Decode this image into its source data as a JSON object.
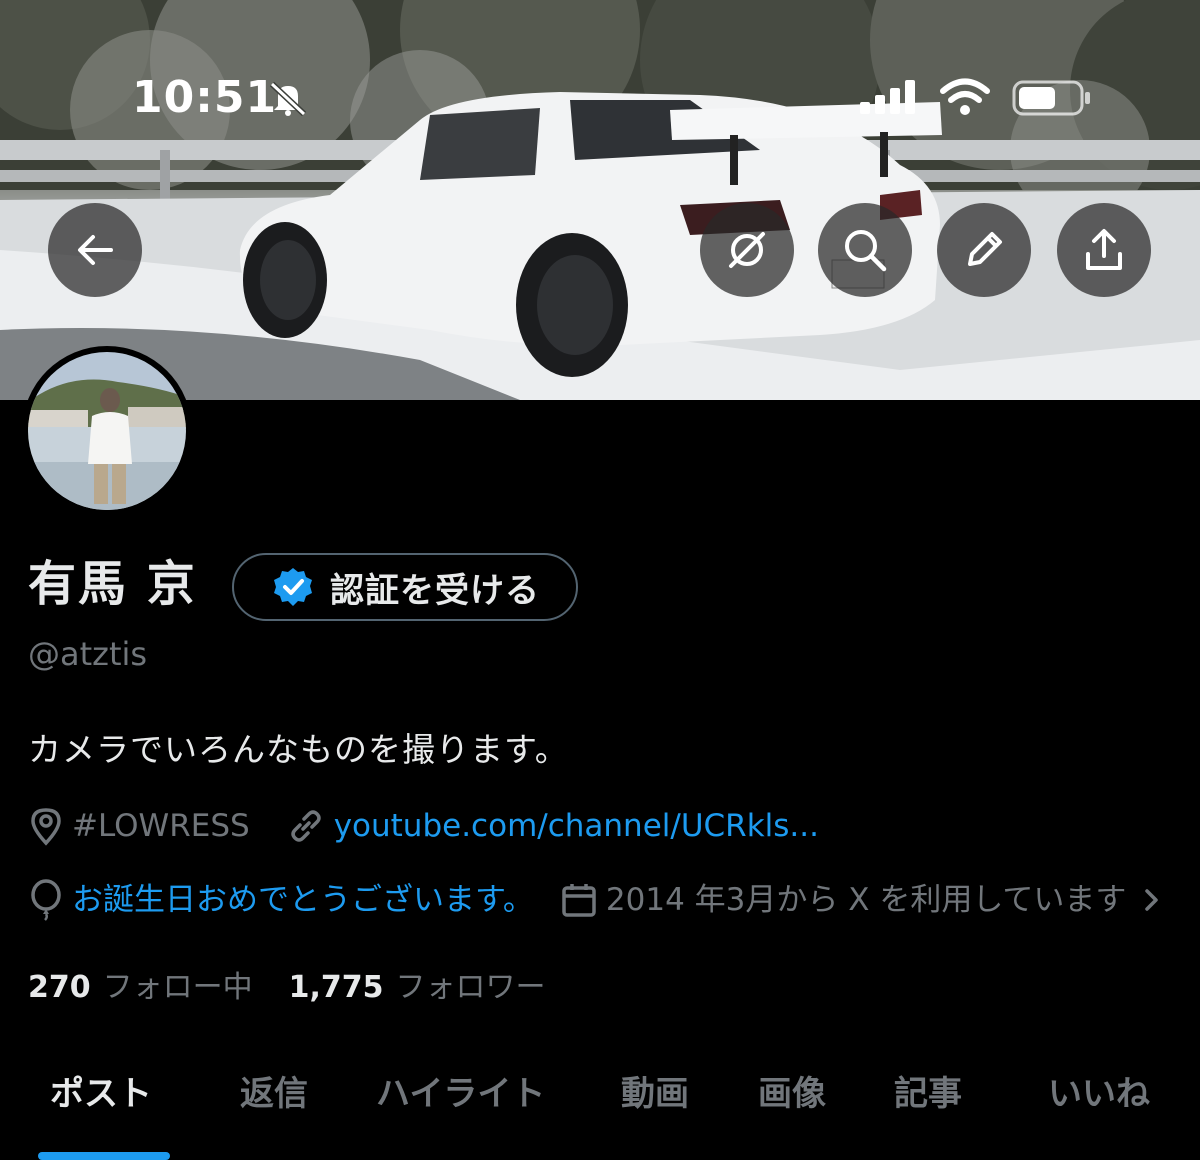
{
  "status_bar": {
    "time": "10:51"
  },
  "header": {
    "back_icon": "arrow-left-icon",
    "actions": [
      "translate-off-icon",
      "search-icon",
      "edit-pencil-icon",
      "share-icon"
    ]
  },
  "profile": {
    "display_name": "有馬 京",
    "verify_button": "認証を受ける",
    "handle": "@atztis",
    "bio": "カメラでいろんなものを撮ります。",
    "location": "#LOWRESS",
    "website": "youtube.com/channel/UCRkls...",
    "birthday": "お誕生日おめでとうございます。",
    "joined": "2014 年3月から X を利用しています",
    "following_count": "270",
    "following_label": "フォロー中",
    "followers_count": "1,775",
    "followers_label": "フォロワー"
  },
  "tabs": [
    {
      "label": "ポスト",
      "active": true
    },
    {
      "label": "返信",
      "active": false
    },
    {
      "label": "ハイライト",
      "active": false
    },
    {
      "label": "動画",
      "active": false
    },
    {
      "label": "画像",
      "active": false
    },
    {
      "label": "記事",
      "active": false
    },
    {
      "label": "いいね",
      "active": false
    }
  ],
  "colors": {
    "accent": "#1d9bf0",
    "muted": "#71767b",
    "text": "#e7e9ea",
    "background": "#000000"
  }
}
